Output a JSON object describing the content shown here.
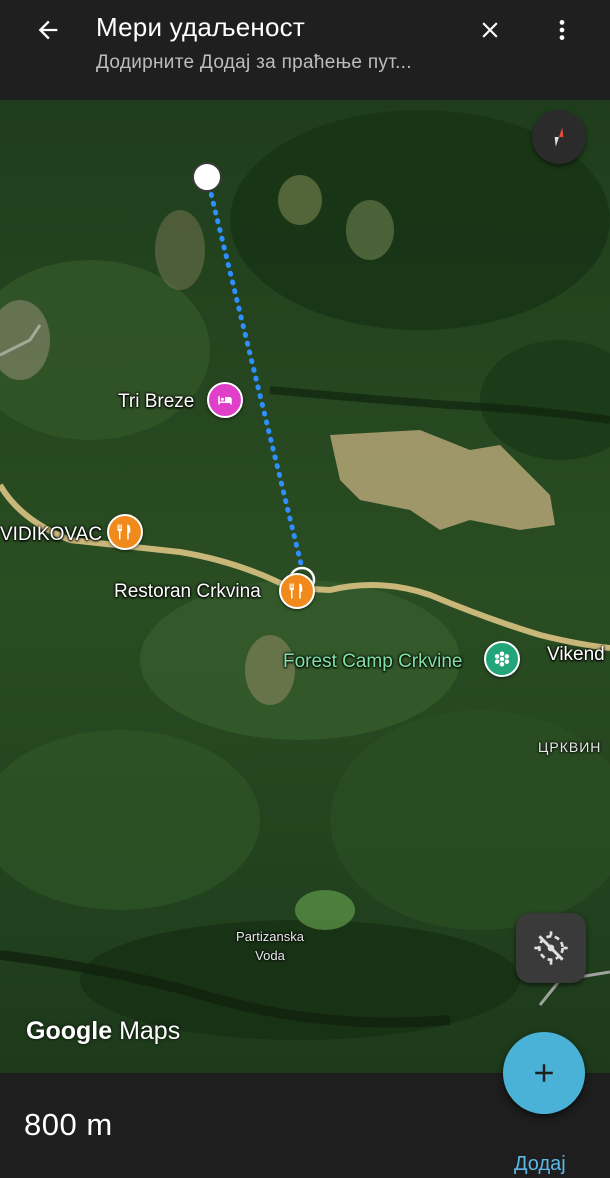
{
  "header": {
    "title": "Мери удаљеност",
    "subtitle": "Додирните Додај за праћење пут..."
  },
  "map": {
    "labels": {
      "tri_breze": "Tri Breze",
      "vidikovac": "VIDIKOVAC",
      "restoran": "Restoran Crkvina",
      "forest_camp": "Forest Camp Crkvine",
      "vikend": "Vikend",
      "crkvine": "ЦРКВИН",
      "partizanska_line1": "Partizanska",
      "partizanska_line2": "Voda"
    },
    "attribution": {
      "google": "Google",
      "maps": "Maps"
    }
  },
  "bottom": {
    "distance": "800 m",
    "add_label": "Додај"
  },
  "colors": {
    "measure_line": "#2f8fff",
    "fab": "#4ab2d6",
    "hotel_pin": "#e040c8",
    "food_pin": "#f08a1c",
    "camp_pin": "#23a57a",
    "link": "#5bb8e6"
  },
  "icons": [
    "back-arrow-icon",
    "close-icon",
    "more-vert-icon",
    "compass-icon",
    "hotel-icon",
    "restaurant-icon",
    "campground-icon",
    "location-off-icon",
    "add-icon"
  ]
}
